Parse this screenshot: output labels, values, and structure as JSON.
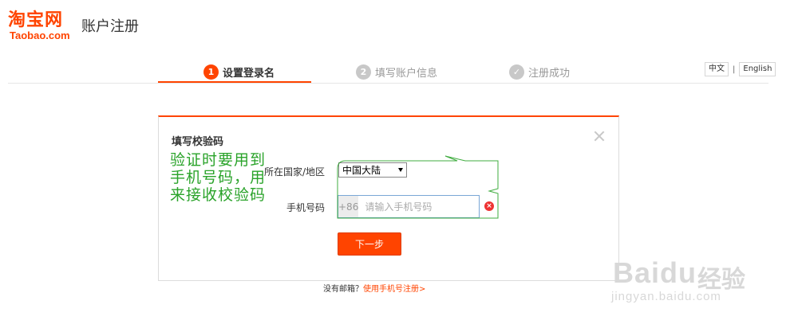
{
  "header": {
    "logo_cn": "淘宝网",
    "logo_en": "Taobao.com",
    "title": "账户注册"
  },
  "steps": [
    {
      "num": "1",
      "label": "设置登录名",
      "state": "active"
    },
    {
      "num": "2",
      "label": "填写账户信息",
      "state": "inactive"
    },
    {
      "num": "✓",
      "label": "注册成功",
      "state": "inactive"
    }
  ],
  "lang": {
    "zh": "中文",
    "sep": "|",
    "en": "English"
  },
  "dialog": {
    "title": "填写校验码",
    "country_label": "所在国家/地区",
    "country_value": "中国大陆",
    "phone_label": "手机号码",
    "phone_prefix": "+86",
    "phone_placeholder": "请输入手机号码",
    "error_glyph": "×",
    "next_label": "下一步"
  },
  "footer": {
    "question": "没有邮箱？",
    "link": "使用手机号注册>"
  },
  "annotation": {
    "text": "验证时要用到手机号码，用来接收校验码"
  },
  "watermark": {
    "main": "Baidu",
    "cn": "经验",
    "url": "jingyan.baidu.com"
  },
  "colors": {
    "accent": "#ff4400",
    "annotation": "#2aa32a"
  }
}
